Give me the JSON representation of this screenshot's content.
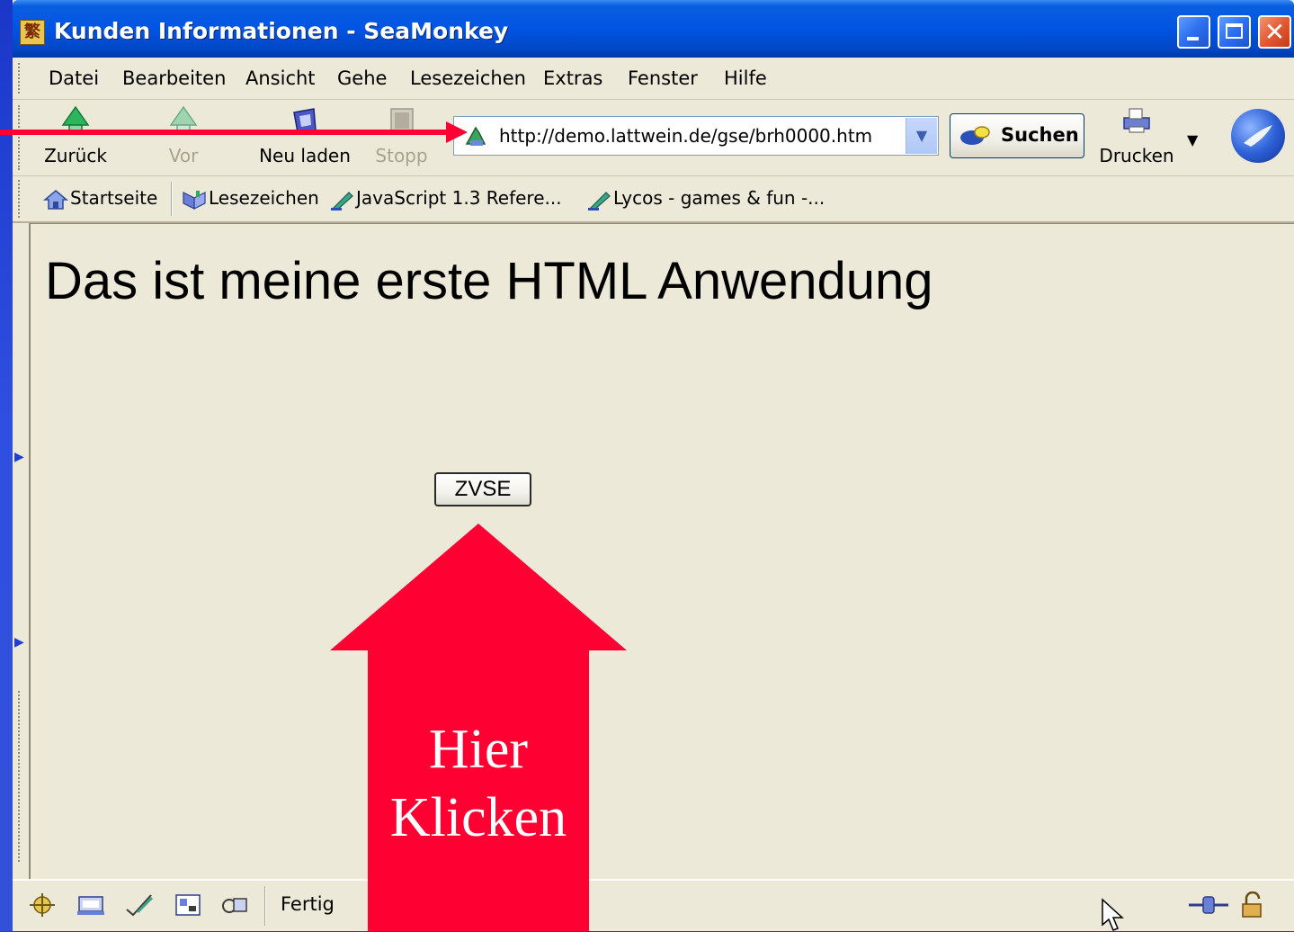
{
  "window": {
    "title": "Kunden Informationen - SeaMonkey",
    "title_icon": "seamonkey-app-icon"
  },
  "menubar": {
    "items": [
      {
        "label": "Datei"
      },
      {
        "label": "Bearbeiten"
      },
      {
        "label": "Ansicht"
      },
      {
        "label": "Gehe"
      },
      {
        "label": "Lesezeichen"
      },
      {
        "label": "Extras"
      },
      {
        "label": "Fenster"
      },
      {
        "label": "Hilfe"
      }
    ]
  },
  "navbar": {
    "back_label": "Zurück",
    "forward_label": "Vor",
    "reload_label": "Neu laden",
    "stop_label": "Stopp",
    "url": "http://demo.lattwein.de/gse/brh0000.htm",
    "search_label": "Suchen",
    "print_label": "Drucken"
  },
  "personalbar": {
    "items": [
      {
        "label": "Startseite",
        "icon": "home-icon"
      },
      {
        "label": "Lesezeichen",
        "icon": "bookmarks-icon"
      },
      {
        "label": "JavaScript 1.3 Refere...",
        "icon": "bookmark-pen-icon"
      },
      {
        "label": "Lycos - games & fun -...",
        "icon": "bookmark-pen-icon"
      }
    ]
  },
  "page": {
    "heading": "Das ist meine erste HTML Anwendung",
    "button_label": "ZVSE"
  },
  "statusbar": {
    "text": "Fertig"
  },
  "annotation": {
    "arrow_text_line1": "Hier",
    "arrow_text_line2": "Klicken",
    "color": "#ff0033"
  }
}
